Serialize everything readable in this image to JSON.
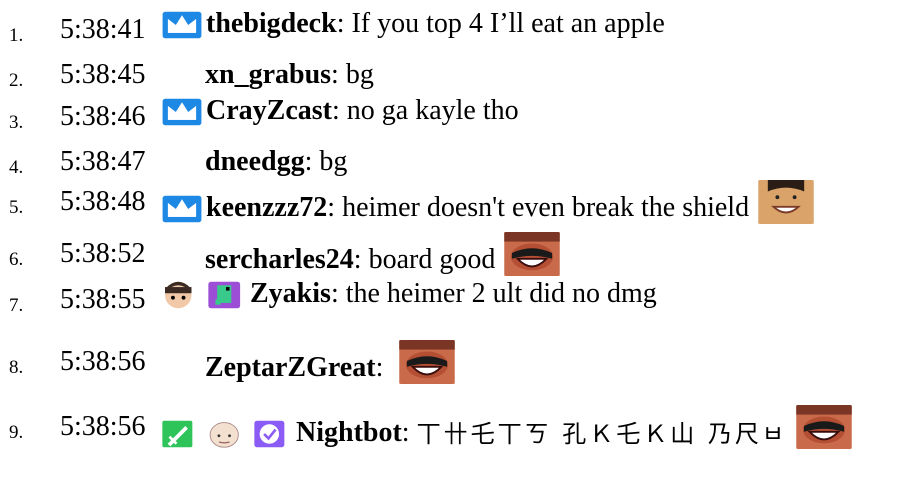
{
  "messages": [
    {
      "num": "1.",
      "time": "5:38:41",
      "badges": [
        "crown-badge"
      ],
      "user": "thebigdeck",
      "sep": ": ",
      "text": "If you top 4 I’ll eat an apple",
      "emote": ""
    },
    {
      "num": "2.",
      "time": "5:38:45",
      "badges": [],
      "user": "xn_grabus",
      "sep": ": ",
      "text": "bg",
      "emote": ""
    },
    {
      "num": "3.",
      "time": "5:38:46",
      "badges": [
        "crown-badge"
      ],
      "user": "CrayZcast",
      "sep": ": ",
      "text": "no ga kayle tho",
      "emote": ""
    },
    {
      "num": "4.",
      "time": "5:38:47",
      "badges": [],
      "user": "dneedgg",
      "sep": ": ",
      "text": "bg",
      "emote": ""
    },
    {
      "num": "5.",
      "time": "5:38:48",
      "badges": [
        "crown-badge"
      ],
      "user": "keenzzz72",
      "sep": ": ",
      "text": "heimer doesn't even break the shield",
      "emote": "smiling-face-emote"
    },
    {
      "num": "6.",
      "time": "5:38:52",
      "badges": [],
      "user": "sercharles24",
      "sep": ": ",
      "text": "board good",
      "emote": "laughing-man-emote"
    },
    {
      "num": "7.",
      "time": "5:38:55",
      "badges": [
        "avatar-badge",
        "dino-badge"
      ],
      "user": "Zyakis",
      "sep": ": ",
      "text": "the heimer 2 ult did no dmg",
      "emote": ""
    },
    {
      "num": "8.",
      "time": "5:38:56",
      "badges": [],
      "user": "ZeptarZGreat",
      "sep": ": ",
      "text": "",
      "emote": "laughing-man-emote"
    },
    {
      "num": "9.",
      "time": "5:38:56",
      "badges": [
        "sword-badge",
        "bald-badge",
        "verified-badge"
      ],
      "user": "Nightbot",
      "sep": ": ",
      "text": "丅卄乇丅ㄎ 孔Ｋ乇Ｋ山 乃尺ㅂ",
      "emote": "laughing-man-emote"
    }
  ],
  "colors": {
    "crown": "#1e88e5",
    "dino": "#9c4fd6",
    "sword": "#2ec45a",
    "verified": "#8a5cf5"
  }
}
